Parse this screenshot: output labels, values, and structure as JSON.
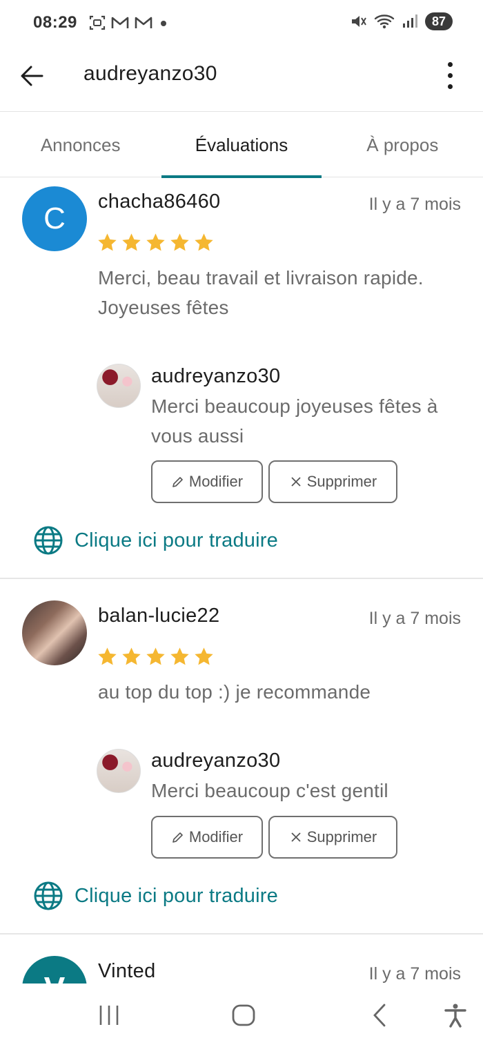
{
  "status_bar": {
    "time": "08:29",
    "battery": "87",
    "left_icons": [
      "screenshot-icon",
      "gmail-icon",
      "gmail-icon",
      "dot-icon"
    ],
    "right_icons": [
      "mute-icon",
      "wifi-icon",
      "signal-icon"
    ]
  },
  "header": {
    "title": "audreyanzo30"
  },
  "tabs": [
    {
      "label": "Annonces",
      "active": false
    },
    {
      "label": "Évaluations",
      "active": true
    },
    {
      "label": "À propos",
      "active": false
    }
  ],
  "reviews": [
    {
      "avatar_letter": "C",
      "reviewer": "chacha86460",
      "date": "Il y a 7 mois",
      "rating": 5,
      "text": "Merci, beau travail et livraison rapide. Joyeuses fêtes",
      "reply": {
        "name": "audreyanzo30",
        "text": "Merci beaucoup joyeuses fêtes à vous aussi",
        "edit_label": "Modifier",
        "delete_label": "Supprimer"
      },
      "translate_label": "Clique ici pour traduire"
    },
    {
      "avatar_letter": "",
      "reviewer": "balan-lucie22",
      "date": "Il y a 7 mois",
      "rating": 5,
      "text": "au top du top :) je recommande",
      "reply": {
        "name": "audreyanzo30",
        "text": "Merci beaucoup c'est gentil",
        "edit_label": "Modifier",
        "delete_label": "Supprimer"
      },
      "translate_label": "Clique ici pour traduire"
    },
    {
      "avatar_letter": "V",
      "reviewer": "Vinted",
      "date": "Il y a 7 mois"
    }
  ],
  "colors": {
    "accent": "#0b7a84",
    "star": "#f5b731",
    "avatar_c": "#1b8ad4"
  },
  "nav": [
    "recent-apps-icon",
    "home-icon",
    "back-icon",
    "accessibility-icon"
  ]
}
